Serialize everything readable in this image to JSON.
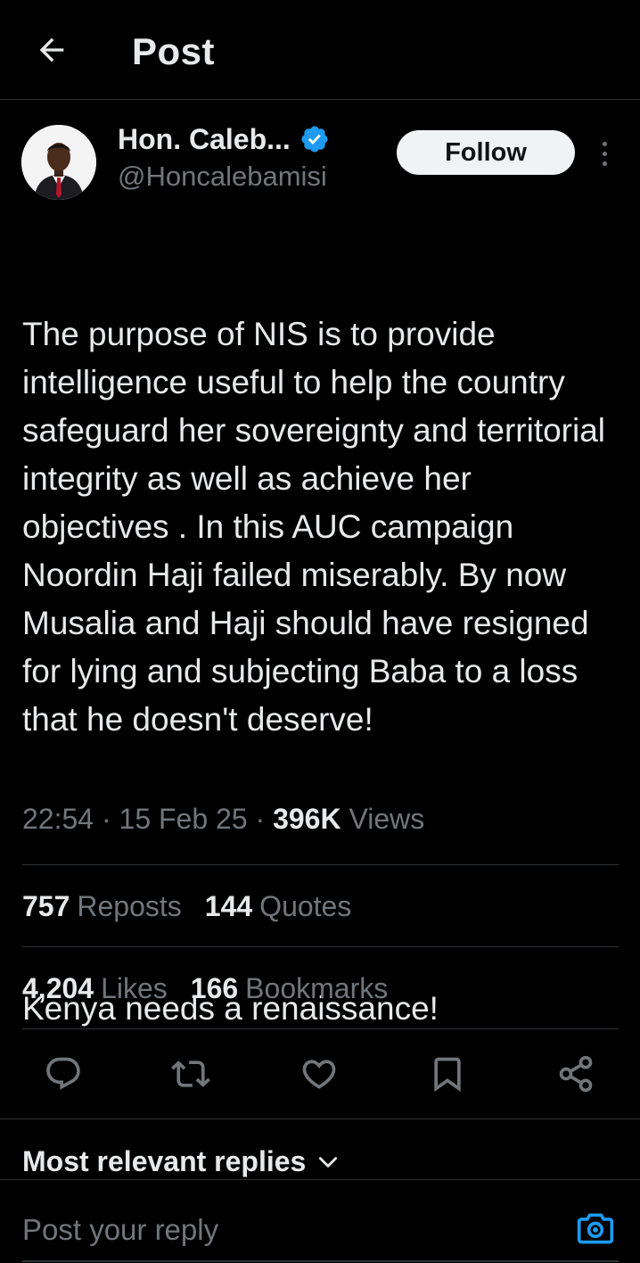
{
  "header": {
    "title": "Post",
    "back_icon": "arrow-left-icon"
  },
  "author": {
    "name": "Hon. Caleb...",
    "handle": "@Honcalebamisi",
    "verified": true,
    "verified_color": "#1d9bf0"
  },
  "follow_label": "Follow",
  "post": {
    "paragraph1": "The purpose of NIS is to provide intelligence useful to help the country  safeguard her sovereignty and territorial integrity as well as achieve her objectives . In this AUC campaign Noordin Haji failed miserably. By now Musalia and Haji should have resigned for lying and subjecting Baba to a loss that he doesn't deserve!",
    "paragraph2": "Kenya needs a renaissance!",
    "time": "22:54",
    "date": "15 Feb 25",
    "views_count": "396K",
    "views_label": "Views"
  },
  "stats": {
    "reposts_count": "757",
    "reposts_label": "Reposts",
    "quotes_count": "144",
    "quotes_label": "Quotes",
    "likes_count": "4,204",
    "likes_label": "Likes",
    "bookmarks_count": "166",
    "bookmarks_label": "Bookmarks"
  },
  "actions": [
    "reply-icon",
    "repost-icon",
    "like-icon",
    "bookmark-icon",
    "share-icon"
  ],
  "replies": {
    "heading": "Most relevant replies"
  },
  "reply_bar": {
    "placeholder": "Post your reply",
    "camera_color": "#1d9bf0"
  },
  "colors": {
    "background": "#000000",
    "text": "#e7e9ea",
    "muted": "#71767b",
    "accent": "#1d9bf0",
    "divider": "#2f3336"
  }
}
